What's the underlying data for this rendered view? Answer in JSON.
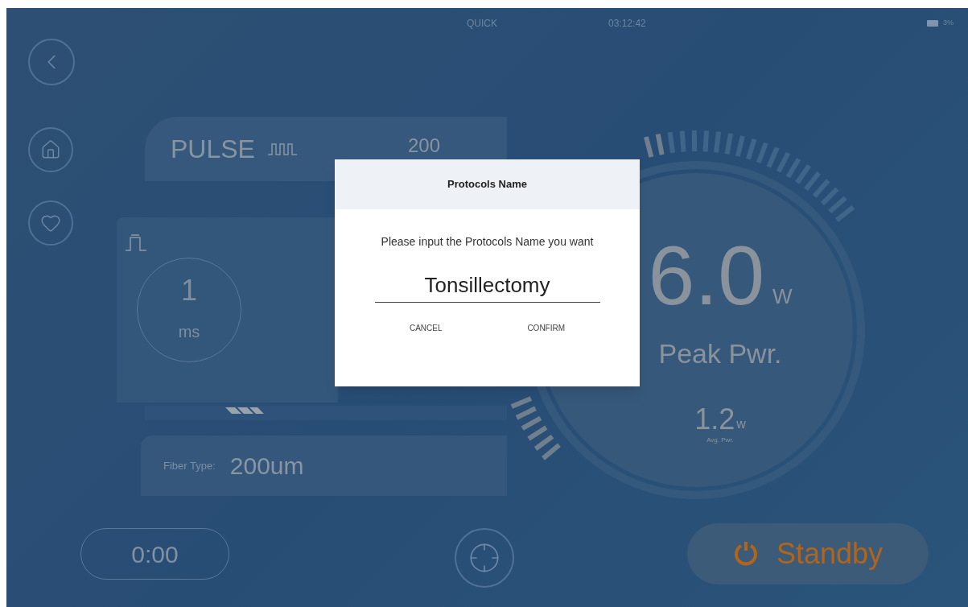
{
  "status_bar": {
    "mode": "QUICK",
    "time": "03:12:42",
    "battery": "3%"
  },
  "pulse_card": {
    "label": "PULSE",
    "value": "200"
  },
  "pulse_width": {
    "value": "1",
    "unit": "ms"
  },
  "fiber": {
    "label": "Fiber Type:",
    "value": "200um"
  },
  "power": {
    "peak": "6.0",
    "peak_unit": "W",
    "peak_label": "Peak Pwr.",
    "avg": "1.2",
    "avg_unit": "w",
    "avg_label": "Avg. Pwr."
  },
  "timer": "0:00",
  "standby": "Standby",
  "dialog": {
    "title": "Protocols Name",
    "prompt": "Please input the Protocols Name you want",
    "value": "Tonsillectomy",
    "buttons": [
      "CANCEL",
      "CONFIRM"
    ]
  }
}
